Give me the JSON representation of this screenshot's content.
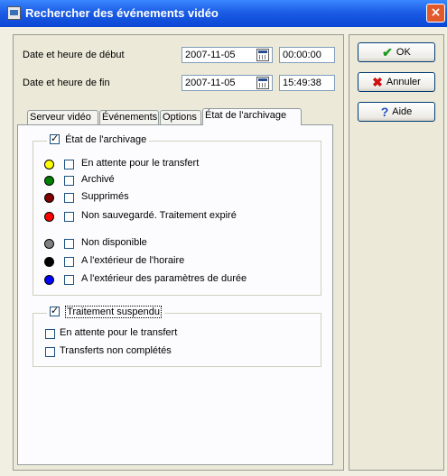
{
  "window": {
    "title": "Rechercher des événements vidéo",
    "close_label": "×"
  },
  "form": {
    "start_label": "Date et heure de début",
    "start_date": "2007-11-05",
    "start_time": "00:00:00",
    "end_label": "Date et heure de fin",
    "end_date": "2007-11-05",
    "end_time": "15:49:38"
  },
  "buttons": {
    "ok": "OK",
    "cancel": "Annuler",
    "help": "Aide"
  },
  "tabs": [
    "Serveur vidéo",
    "Événements",
    "Options",
    "État de l'archivage"
  ],
  "archive_group": {
    "title": "État de l'archivage",
    "items": [
      {
        "label": "En attente pour le transfert",
        "color": "#ffff00"
      },
      {
        "label": "Archivé",
        "color": "#008000"
      },
      {
        "label": "Supprimés",
        "color": "#800000"
      },
      {
        "label": "Non sauvegardé. Traitement expiré",
        "color": "#ff0000"
      },
      {
        "label": "Non disponible",
        "color": "#808080"
      },
      {
        "label": "A l'extérieur de l'horaire",
        "color": "#000000"
      },
      {
        "label": "A l'extérieur des paramètres de durée",
        "color": "#0000ff"
      }
    ]
  },
  "suspended_group": {
    "title": "Traitement suspendu",
    "items": [
      "En attente pour le transfert",
      "Transferts non complétés"
    ]
  }
}
